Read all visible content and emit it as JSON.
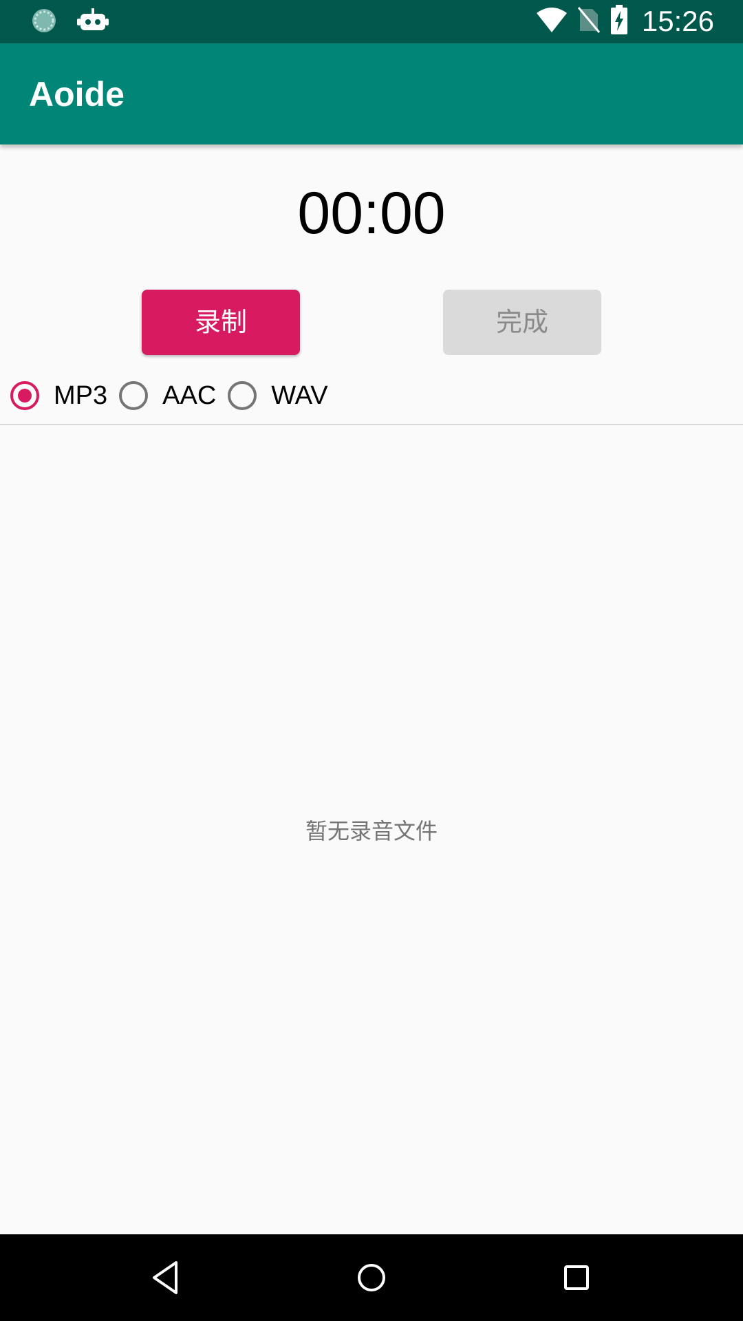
{
  "status_bar": {
    "time": "15:26",
    "icons": [
      "sync-icon",
      "android-debug-icon",
      "wifi-icon",
      "no-sim-icon",
      "battery-charging-icon"
    ],
    "background": "#00574b"
  },
  "app_bar": {
    "title": "Aoide",
    "background": "#008577"
  },
  "timer": {
    "value": "00:00"
  },
  "buttons": {
    "record_label": "录制",
    "done_label": "完成",
    "record_color": "#d81b60",
    "done_color": "#dadada"
  },
  "formats": {
    "selected": "MP3",
    "options": [
      {
        "label": "MP3",
        "checked": true
      },
      {
        "label": "AAC",
        "checked": false
      },
      {
        "label": "WAV",
        "checked": false
      }
    ],
    "accent_color": "#d81b60"
  },
  "list": {
    "empty_message": "暂无录音文件"
  },
  "nav_bar": {
    "icons": [
      "back-icon",
      "home-icon",
      "recents-icon"
    ]
  }
}
